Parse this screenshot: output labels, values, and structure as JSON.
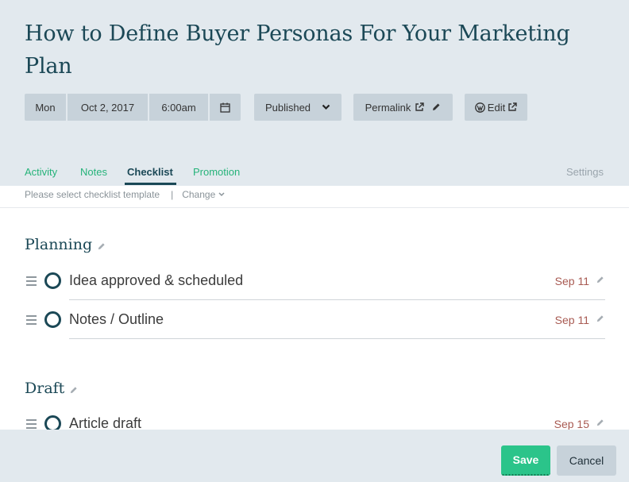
{
  "post": {
    "title": "How to Define Buyer Personas For Your Marketing Plan"
  },
  "schedule": {
    "day": "Mon",
    "date": "Oct 2, 2017",
    "time": "6:00am",
    "status": "Published"
  },
  "links": {
    "permalink_label": "Permalink",
    "edit_label": "Edit"
  },
  "tabs": {
    "items": [
      {
        "label": "Activity"
      },
      {
        "label": "Notes"
      },
      {
        "label": "Checklist",
        "active": true
      },
      {
        "label": "Promotion"
      }
    ],
    "settings_label": "Settings"
  },
  "checklist": {
    "template_prompt": "Please select checklist template",
    "separator": "|",
    "change_label": "Change",
    "sections": [
      {
        "title": "Planning",
        "items": [
          {
            "label": "Idea approved & scheduled",
            "date": "Sep 11"
          },
          {
            "label": "Notes / Outline",
            "date": "Sep 11"
          }
        ]
      },
      {
        "title": "Draft",
        "items": [
          {
            "label": "Article draft",
            "date": "Sep 15"
          }
        ]
      }
    ]
  },
  "footer": {
    "save_label": "Save",
    "cancel_label": "Cancel"
  },
  "colors": {
    "header_bg": "#e2e9ee",
    "title": "#1b4856",
    "tab_accent": "#26b37a",
    "date": "#a85a52",
    "save_button": "#2bc48a"
  },
  "icons": {
    "calendar": "calendar-icon",
    "status_dropdown": "chevron-down-icon",
    "external": "external-link-icon",
    "pencil": "pencil-icon",
    "wordpress": "wordpress-icon",
    "drag": "drag-handle-icon",
    "check": "checkbox-circle-icon"
  }
}
